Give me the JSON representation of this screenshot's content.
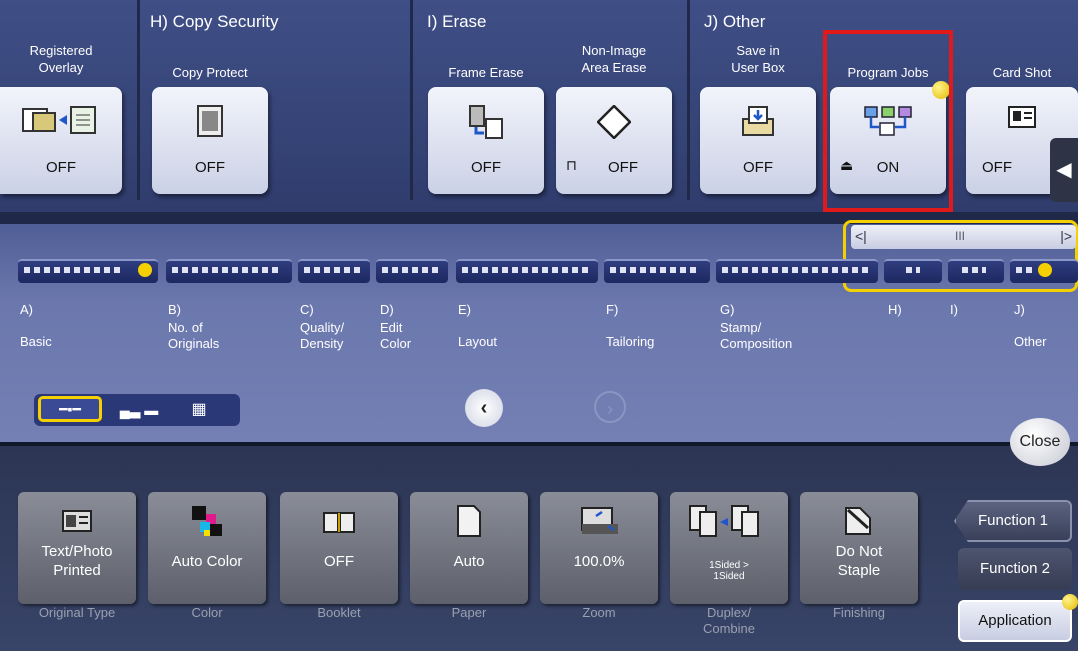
{
  "groups": {
    "h": "H)  Copy Security",
    "i": "I)   Erase",
    "j": "J)   Other"
  },
  "top_buttons": [
    {
      "label": "Registered\nOverlay",
      "value": "OFF"
    },
    {
      "label": "Copy Protect",
      "value": "OFF"
    },
    {
      "label": "Frame Erase",
      "value": "OFF"
    },
    {
      "label": "Non-Image\nArea Erase",
      "value": "OFF"
    },
    {
      "label": "Save in\nUser Box",
      "value": "OFF"
    },
    {
      "label": "Program Jobs",
      "value": "ON"
    },
    {
      "label": "Card Shot",
      "value": "OFF"
    }
  ],
  "tabs": [
    {
      "key": "A)",
      "label": "Basic"
    },
    {
      "key": "B)",
      "label": "No. of\nOriginals"
    },
    {
      "key": "C)",
      "label": "Quality/\nDensity"
    },
    {
      "key": "D)",
      "label": "Edit\nColor"
    },
    {
      "key": "E)",
      "label": "Layout"
    },
    {
      "key": "F)",
      "label": "Tailoring"
    },
    {
      "key": "G)",
      "label": "Stamp/\nComposition"
    },
    {
      "key": "H)",
      "label": ""
    },
    {
      "key": "I)",
      "label": ""
    },
    {
      "key": "J)",
      "label": "Other"
    }
  ],
  "scroll_mark": "III",
  "close_label": "Close",
  "bottom_buttons": [
    {
      "value": "Text/Photo\nPrinted",
      "caption": "Original Type"
    },
    {
      "value": "Auto Color",
      "caption": "Color"
    },
    {
      "value": "OFF",
      "caption": "Booklet"
    },
    {
      "value": "Auto",
      "caption": "Paper"
    },
    {
      "value": "100.0%",
      "caption": "Zoom"
    },
    {
      "value": "1Sided >\n1Sided",
      "caption": "Duplex/\nCombine"
    },
    {
      "value": "Do Not\nStaple",
      "caption": "Finishing"
    }
  ],
  "side": {
    "f1": "Function 1",
    "f2": "Function 2",
    "app": "Application"
  },
  "colors": {
    "highlight": "#e01a1a",
    "accent_yellow": "#f5d000"
  }
}
